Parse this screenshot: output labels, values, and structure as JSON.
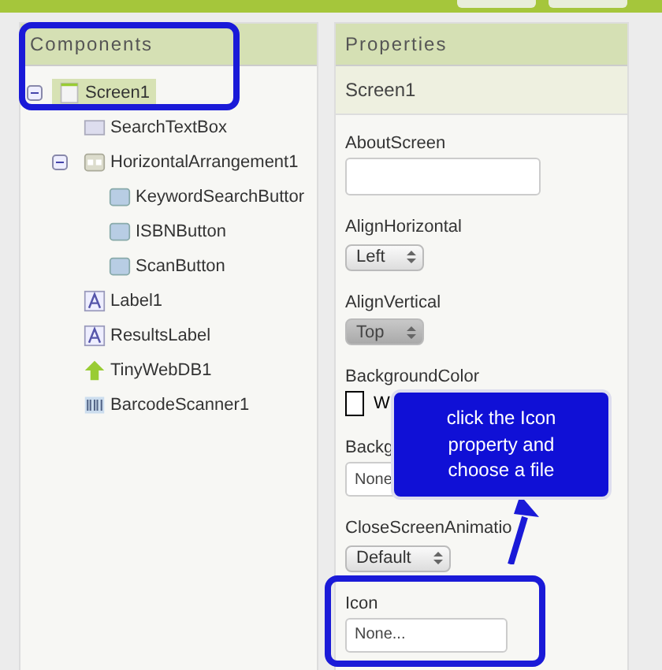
{
  "components": {
    "title": "Components",
    "tree": [
      {
        "label": "Screen1",
        "kind": "screen",
        "expanded": true,
        "selected": true,
        "children": [
          {
            "label": "SearchTextBox",
            "kind": "textbox",
            "selected": false
          },
          {
            "label": "HorizontalArrangement1",
            "kind": "arrangement",
            "expanded": true,
            "selected": false,
            "children": [
              {
                "label": "KeywordSearchButtor",
                "kind": "button",
                "selected": false
              },
              {
                "label": "ISBNButton",
                "kind": "button",
                "selected": false
              },
              {
                "label": "ScanButton",
                "kind": "button",
                "selected": false
              }
            ]
          },
          {
            "label": "Label1",
            "kind": "label",
            "selected": false
          },
          {
            "label": "ResultsLabel",
            "kind": "label",
            "selected": false
          },
          {
            "label": "TinyWebDB1",
            "kind": "storage",
            "selected": false
          },
          {
            "label": "BarcodeScanner1",
            "kind": "scanner",
            "selected": false
          }
        ]
      }
    ]
  },
  "properties": {
    "title": "Properties",
    "component": "Screen1",
    "items": [
      {
        "label": "AboutScreen",
        "kind": "textarea"
      },
      {
        "label": "AlignHorizontal",
        "kind": "select",
        "value": "Left",
        "disabled": false
      },
      {
        "label": "AlignVertical",
        "kind": "select",
        "value": "Top",
        "disabled": true
      },
      {
        "label": "BackgroundColor",
        "kind": "color",
        "color": "#ffffff",
        "value": "W"
      },
      {
        "label": "Backg",
        "kind": "file",
        "value": "None"
      },
      {
        "label": "CloseScreenAnimatio",
        "kind": "select",
        "value": "Default",
        "disabled": false
      },
      {
        "label": "Icon",
        "kind": "file",
        "value": "None..."
      }
    ]
  },
  "callout": {
    "text": "click the Icon property and choose a file"
  }
}
